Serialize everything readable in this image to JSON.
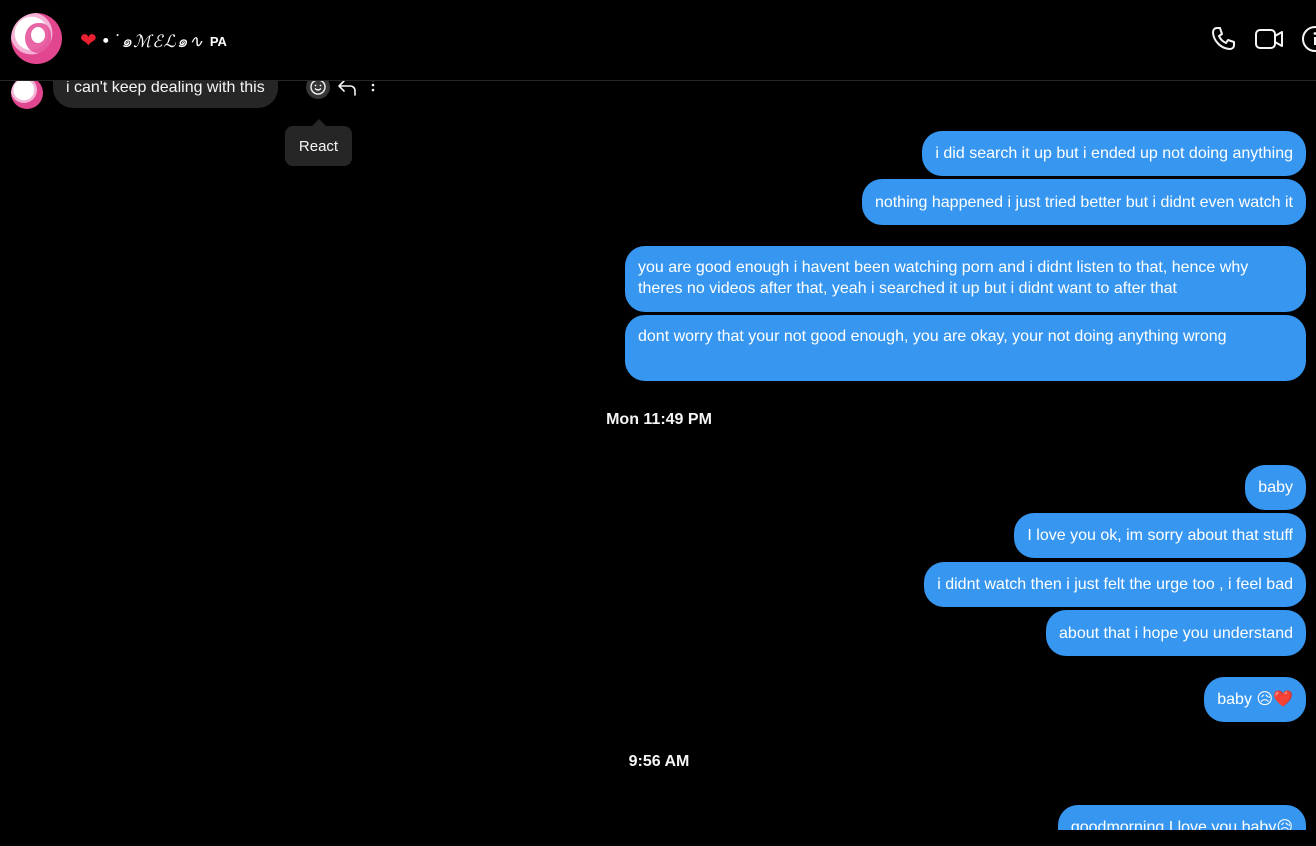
{
  "header": {
    "contact_name": "•˙๑ℳℰℒ๑∿",
    "contact_suffix": "PA",
    "heart": "❤",
    "icons": [
      "phone-icon",
      "video-call-icon",
      "info-icon"
    ]
  },
  "incoming": {
    "text": "i can't keep dealing with this",
    "actions": [
      "react-icon",
      "reply-icon",
      "more-options-icon"
    ]
  },
  "tooltip": {
    "label": "React"
  },
  "messages": [
    {
      "text": "i did search it up but i ended up not doing anything"
    },
    {
      "text": "nothing happened i just tried better but i didnt even watch it"
    },
    {
      "text": "you are good enough i havent been watching porn and i didnt listen to that, hence why theres no videos after that, yeah i searched it up but i didnt want to after that"
    },
    {
      "text": "dont worry that your not good enough, you are okay, your not doing anything wrong"
    },
    {
      "text": "baby"
    },
    {
      "text": "I love you ok, im sorry about that stuff"
    },
    {
      "text": "i didnt watch then i just felt the urge too , i feel bad"
    },
    {
      "text": "about that i hope you understand"
    },
    {
      "text": "baby 😥❤️"
    },
    {
      "text": "goodmorning I love you baby😥"
    }
  ],
  "timestamps": [
    "Mon 11:49 PM",
    "9:56 AM"
  ],
  "colors": {
    "outgoing_bubble": "#3797f0",
    "incoming_bubble": "#262626",
    "background": "#000000"
  }
}
